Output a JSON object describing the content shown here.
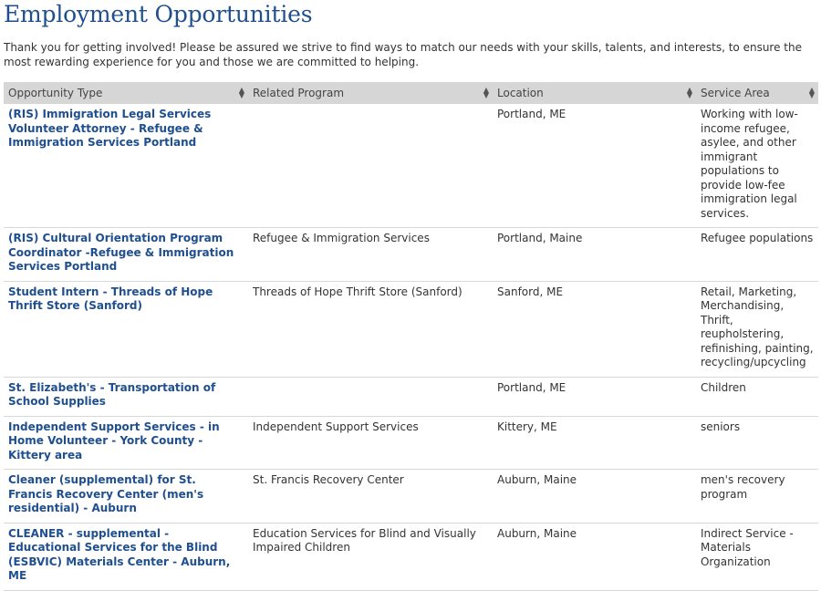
{
  "page": {
    "title": "Employment Opportunities",
    "intro": "Thank you for getting involved! Please be assured we strive to find ways to match our needs with your skills, talents, and interests, to ensure the most rewarding experience for you and those we are committed to helping."
  },
  "table": {
    "headers": [
      "Opportunity Type",
      "Related Program",
      "Location",
      "Service Area"
    ],
    "sort_icon": "sort-updown-icon",
    "link_color": "#1f4f8f",
    "header_bg": "#d6d6d6",
    "rows": [
      {
        "type": "(RIS) Immigration Legal Services Volunteer Attorney - Refugee & Immigration Services Portland",
        "program": "",
        "location": "Portland, ME",
        "service": "Working with low-income refugee, asylee, and other immigrant populations to provide low-fee immigration legal services."
      },
      {
        "type": "(RIS) Cultural Orientation Program Coordinator -Refugee & Immigration Services Portland",
        "program": "Refugee & Immigration Services",
        "location": "Portland, Maine",
        "service": "Refugee populations"
      },
      {
        "type": "Student Intern - Threads of Hope Thrift Store (Sanford)",
        "program": "Threads of Hope Thrift Store (Sanford)",
        "location": "Sanford, ME",
        "service": "Retail, Marketing, Merchandising, Thrift, reupholstering, refinishing, painting, recycling/upcycling"
      },
      {
        "type": "St. Elizabeth's - Transportation of School Supplies",
        "program": "",
        "location": "Portland, ME",
        "service": "Children"
      },
      {
        "type": "Independent Support Services - in Home Volunteer - York County - Kittery area",
        "program": "Independent Support Services",
        "location": "Kittery, ME",
        "service": "seniors"
      },
      {
        "type": "Cleaner (supplemental) for St. Francis Recovery Center (men's residential) - Auburn",
        "program": "St. Francis Recovery Center",
        "location": "Auburn, Maine",
        "service": "men's recovery program"
      },
      {
        "type": "CLEANER - supplemental - Educational Services for the Blind (ESBVIC) Materials Center - Auburn, ME",
        "program": "Education Services for Blind and Visually Impaired Children",
        "location": "Auburn, Maine",
        "service": "Indirect Service - Materials Organization"
      }
    ]
  }
}
